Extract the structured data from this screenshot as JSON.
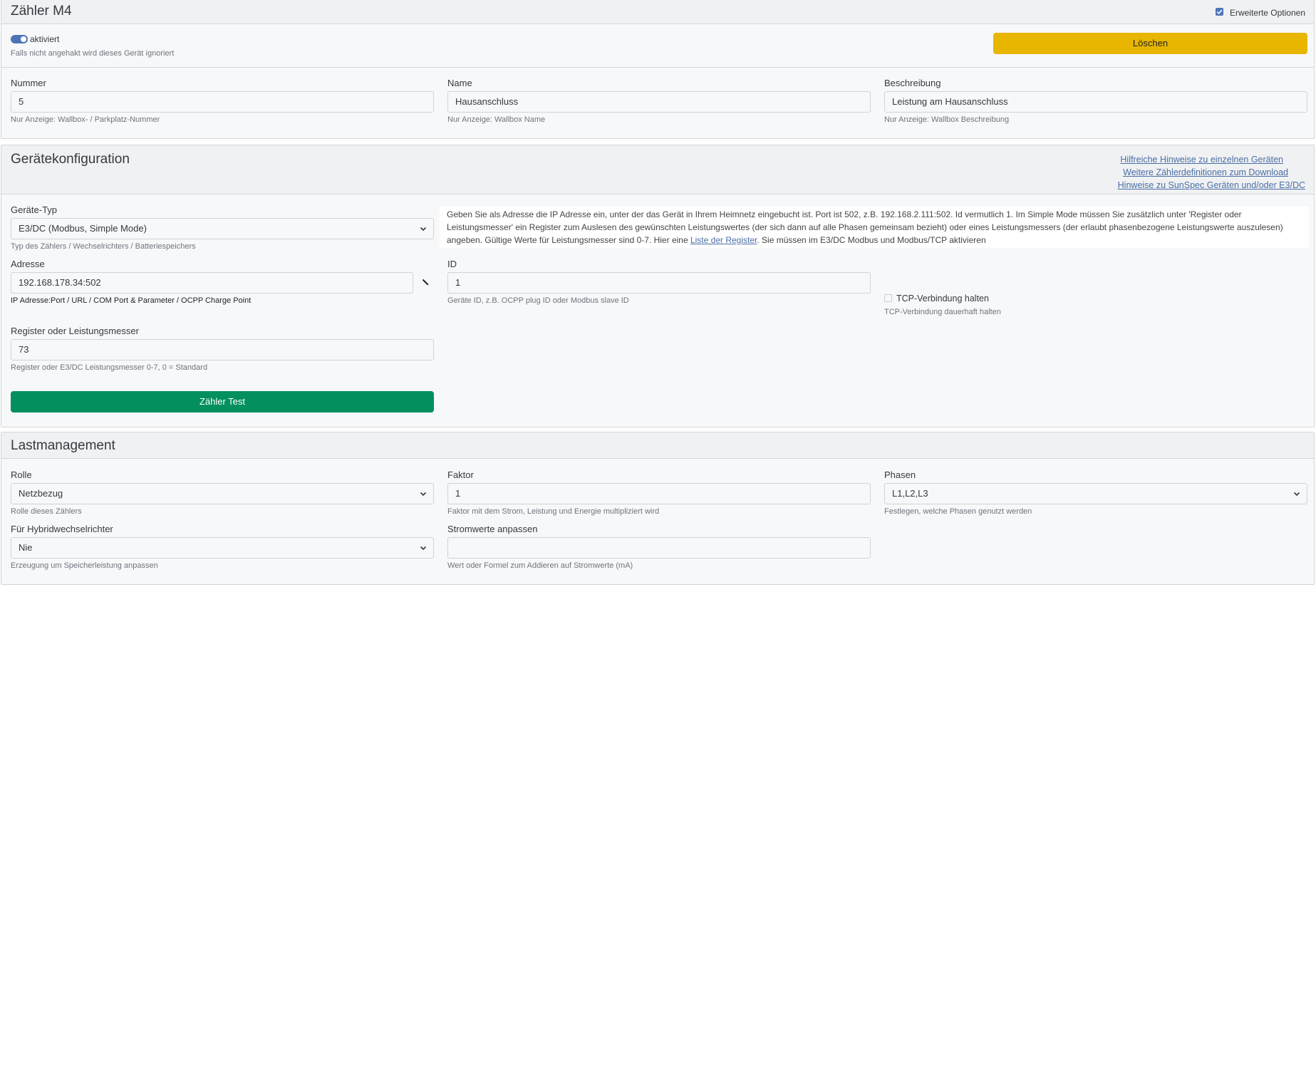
{
  "meter": {
    "title": "Zähler M4",
    "advanced_options_label": "Erweiterte Optionen",
    "active_label": "aktiviert",
    "active_hint": "Falls nicht angehakt wird dieses Gerät ignoriert",
    "delete_label": "Löschen",
    "number": {
      "label": "Nummer",
      "value": "5",
      "hint": "Nur Anzeige: Wallbox- / Parkplatz-Nummer"
    },
    "name": {
      "label": "Name",
      "value": "Hausanschluss",
      "hint": "Nur Anzeige: Wallbox Name"
    },
    "description": {
      "label": "Beschreibung",
      "value": "Leistung am Hausanschluss",
      "hint": "Nur Anzeige: Wallbox Beschreibung"
    }
  },
  "device_config": {
    "title": "Gerätekonfiguration",
    "links": [
      "Hilfreiche Hinweise zu einzelnen Geräten",
      "Weitere Zählerdefinitionen zum Download",
      "Hinweise zu SunSpec Geräten und/oder E3/DC"
    ],
    "device_type": {
      "label": "Geräte-Typ",
      "value": "E3/DC (Modbus, Simple Mode)",
      "hint": "Typ des Zählers / Wechselrichters / Batteriespeichers"
    },
    "info": {
      "text_before": "Geben Sie als Adresse die IP Adresse ein, unter der das Gerät in Ihrem Heimnetz eingebucht ist. Port ist 502, z.B. 192.168.2.111:502. Id vermutlich 1. Im Simple Mode müssen Sie zusätzlich unter 'Register oder Leistungsmesser' ein Register zum Auslesen des gewünschten Leistungswertes (der sich dann auf alle Phasen gemeinsam bezieht) oder eines Leistungsmessers (der erlaubt phasenbezogene Leistungswerte auszulesen) angeben. Gültige Werte für Leistungsmesser sind 0-7. Hier eine ",
      "link_text": "Liste der Register",
      "text_after": ". Sie müssen im E3/DC Modbus und Modbus/TCP aktivieren"
    },
    "address": {
      "label": "Adresse",
      "value": "192.168.178.34:502",
      "hint": "IP Adresse:Port / URL / COM Port & Parameter / OCPP Charge Point"
    },
    "id": {
      "label": "ID",
      "value": "1",
      "hint": "Geräte ID, z.B. OCPP plug ID oder Modbus slave ID"
    },
    "tcp": {
      "label": "TCP-Verbindung halten",
      "hint": "TCP-Verbindung dauerhaft halten"
    },
    "register": {
      "label": "Register oder Leistungsmesser",
      "value": "73",
      "hint": "Register oder E3/DC Leistungsmesser 0-7, 0 = Standard"
    },
    "test_label": "Zähler Test"
  },
  "load_management": {
    "title": "Lastmanagement",
    "role": {
      "label": "Rolle",
      "value": "Netzbezug",
      "hint": "Rolle dieses Zählers"
    },
    "factor": {
      "label": "Faktor",
      "value": "1",
      "hint": "Faktor mit dem Strom, Leistung und Energie multipliziert wird"
    },
    "phases": {
      "label": "Phasen",
      "value": "L1,L2,L3",
      "hint": "Festlegen, welche Phasen genutzt werden"
    },
    "hybrid": {
      "label": "Für Hybridwechselrichter",
      "value": "Nie",
      "hint": "Erzeugung um Speicherleistung anpassen"
    },
    "current_adjust": {
      "label": "Stromwerte anpassen",
      "value": "",
      "hint": "Wert oder Formel zum Addieren auf Stromwerte (mA)"
    }
  },
  "colors": {
    "warning": "#e8b500",
    "success": "#03905e",
    "toggle": "#4e74b8",
    "link": "#4a6fa5"
  },
  "icons": [
    "chevron-down-icon",
    "pencil-icon",
    "check-icon"
  ]
}
